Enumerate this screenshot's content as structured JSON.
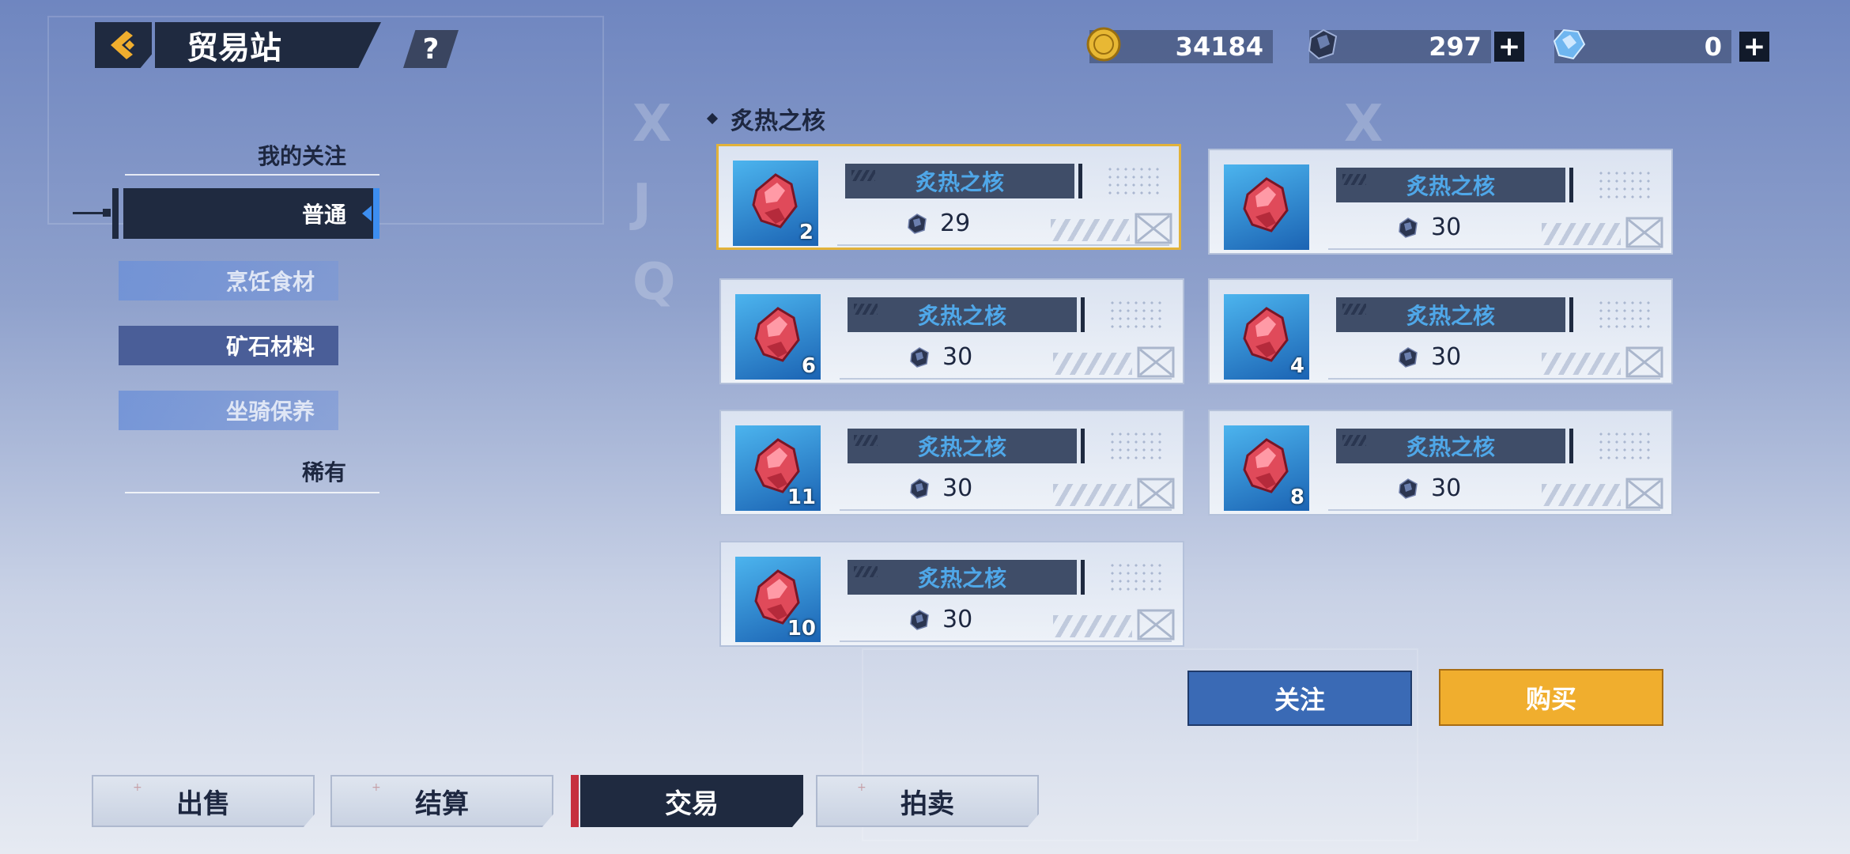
{
  "header": {
    "title": "贸易站",
    "help_label": "?",
    "back_icon": "back-arrow-icon"
  },
  "currencies": [
    {
      "name": "gold-coin-icon",
      "value": "34184",
      "has_plus": false
    },
    {
      "name": "dark-crystal-icon",
      "value": "297",
      "has_plus": true
    },
    {
      "name": "blue-crystal-icon",
      "value": "0",
      "has_plus": true
    }
  ],
  "plus_label": "+",
  "sidebar": {
    "favorites": "我的关注",
    "categories": [
      {
        "label": "普通",
        "active": true
      },
      {
        "label": "烹饪食材",
        "active": false
      },
      {
        "label": "矿石材料",
        "active": false
      },
      {
        "label": "坐骑保养",
        "active": false
      }
    ],
    "rare": "稀有"
  },
  "section": {
    "title": "炙热之核"
  },
  "items": [
    {
      "name": "炙热之核",
      "qty": "2",
      "price": "29",
      "selected": true
    },
    {
      "name": "炙热之核",
      "qty": "",
      "price": "30",
      "selected": false
    },
    {
      "name": "炙热之核",
      "qty": "6",
      "price": "30",
      "selected": false
    },
    {
      "name": "炙热之核",
      "qty": "4",
      "price": "30",
      "selected": false
    },
    {
      "name": "炙热之核",
      "qty": "11",
      "price": "30",
      "selected": false
    },
    {
      "name": "炙热之核",
      "qty": "8",
      "price": "30",
      "selected": false
    },
    {
      "name": "炙热之核",
      "qty": "10",
      "price": "30",
      "selected": false
    }
  ],
  "actions": {
    "follow": "关注",
    "buy": "购买"
  },
  "tabs": [
    {
      "label": "出售",
      "active": false
    },
    {
      "label": "结算",
      "active": false
    },
    {
      "label": "交易",
      "active": true
    },
    {
      "label": "拍卖",
      "active": false
    }
  ],
  "colors": {
    "accent_gold": "#f0ae2e",
    "accent_blue": "#3a6ab5",
    "panel_dark": "#1f2a40",
    "selected_border": "#e2b23a"
  }
}
